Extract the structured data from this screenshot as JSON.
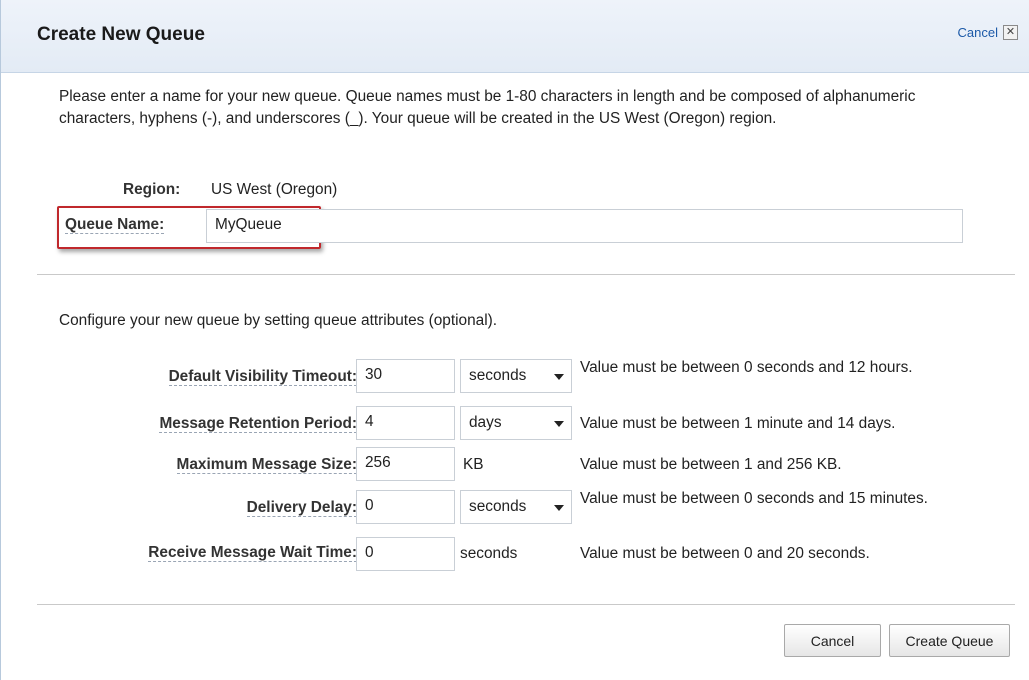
{
  "dialog": {
    "title": "Create New Queue",
    "cancel_link": "Cancel",
    "close_glyph": "✕"
  },
  "intro": "Please enter a name for your new queue. Queue names must be 1-80 characters in length and be composed of alphanumeric characters, hyphens (-), and underscores (_). Your queue will be created in the US West (Oregon) region.",
  "region": {
    "label": "Region:",
    "value": "US West (Oregon)"
  },
  "queue_name": {
    "label": "Queue Name:",
    "value": "MyQueue"
  },
  "config_intro": "Configure your new queue by setting queue attributes (optional).",
  "attributes": {
    "visibility_timeout": {
      "label": "Default Visibility Timeout:",
      "value": "30",
      "unit": "seconds",
      "hint": "Value must be between 0 seconds and 12 hours."
    },
    "retention_period": {
      "label": "Message Retention Period:",
      "value": "4",
      "unit": "days",
      "hint": "Value must be between 1 minute and 14 days."
    },
    "max_message_size": {
      "label": "Maximum Message Size:",
      "value": "256",
      "unit": "KB",
      "hint": "Value must be between 1 and 256 KB."
    },
    "delivery_delay": {
      "label": "Delivery Delay:",
      "value": "0",
      "unit": "seconds",
      "hint": "Value must be between 0 seconds and 15 minutes."
    },
    "receive_wait_time": {
      "label": "Receive Message Wait Time:",
      "value": "0",
      "unit": "seconds",
      "hint": "Value must be between 0 and 20 seconds."
    }
  },
  "buttons": {
    "cancel": "Cancel",
    "create": "Create Queue"
  },
  "colors": {
    "highlight_border": "#c0282c",
    "link": "#1d5aa8",
    "header_bg": "#e8eef7"
  },
  "icons": {
    "close": "close-icon",
    "dropdown": "chevron-down-icon"
  }
}
